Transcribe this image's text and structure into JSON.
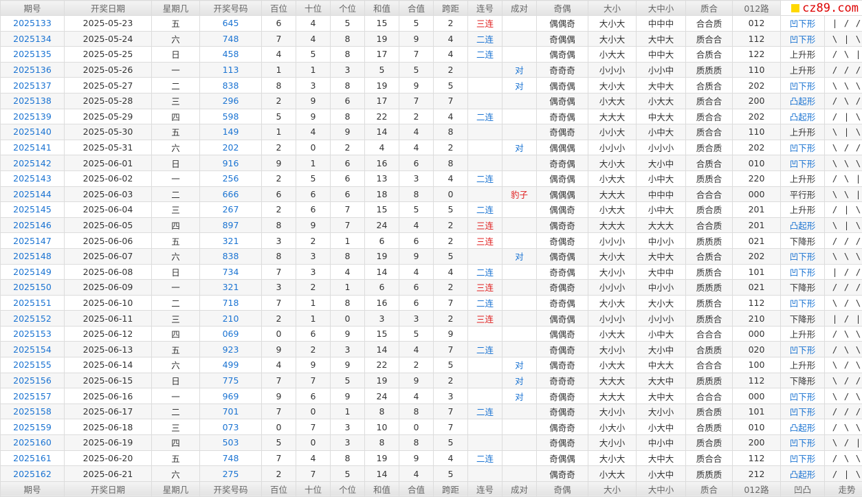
{
  "site": {
    "logo_text": "cz89.com"
  },
  "headers": [
    "期号",
    "开奖日期",
    "星期几",
    "开奖号码",
    "百位",
    "十位",
    "个位",
    "和值",
    "合值",
    "跨距",
    "连号",
    "成对",
    "奇偶",
    "大小",
    "大中小",
    "质合",
    "012路",
    "凹凸",
    "走势"
  ],
  "footer": [
    "期号",
    "开奖日期",
    "星期几",
    "开奖号码",
    "百位",
    "十位",
    "个位",
    "和值",
    "合值",
    "跨距",
    "连号",
    "成对",
    "奇偶",
    "大小",
    "大中小",
    "质合",
    "012路",
    "凹凸",
    "走势"
  ],
  "colors": {
    "blue": "#1a73d2",
    "red": "#e02020",
    "logo_red": "#dd0000",
    "logo_yellow": "#ffd800"
  },
  "rows": [
    {
      "issue": "2025133",
      "date": "2025-05-23",
      "weekday": "五",
      "number": "645",
      "hundreds": "6",
      "tens": "4",
      "units": "5",
      "sum": "15",
      "sum_tail": "5",
      "span": "2",
      "consecutive": "三连",
      "pair": "",
      "odd_even": "偶偶奇",
      "size": "大小大",
      "big_mid_small": "中中中",
      "prime": "合合质",
      "route": "012",
      "shape": "凹下形",
      "trend": "| / /"
    },
    {
      "issue": "2025134",
      "date": "2025-05-24",
      "weekday": "六",
      "number": "748",
      "hundreds": "7",
      "tens": "4",
      "units": "8",
      "sum": "19",
      "sum_tail": "9",
      "span": "4",
      "consecutive": "二连",
      "pair": "",
      "odd_even": "奇偶偶",
      "size": "大小大",
      "big_mid_small": "大中大",
      "prime": "质合合",
      "route": "112",
      "shape": "凹下形",
      "trend": "\\ | \\"
    },
    {
      "issue": "2025135",
      "date": "2025-05-25",
      "weekday": "日",
      "number": "458",
      "hundreds": "4",
      "tens": "5",
      "units": "8",
      "sum": "17",
      "sum_tail": "7",
      "span": "4",
      "consecutive": "二连",
      "pair": "",
      "odd_even": "偶奇偶",
      "size": "小大大",
      "big_mid_small": "中中大",
      "prime": "合质合",
      "route": "122",
      "shape": "上升形",
      "trend": "/ \\ |"
    },
    {
      "issue": "2025136",
      "date": "2025-05-26",
      "weekday": "一",
      "number": "113",
      "hundreds": "1",
      "tens": "1",
      "units": "3",
      "sum": "5",
      "sum_tail": "5",
      "span": "2",
      "consecutive": "",
      "pair": "对",
      "odd_even": "奇奇奇",
      "size": "小小小",
      "big_mid_small": "小小中",
      "prime": "质质质",
      "route": "110",
      "shape": "上升形",
      "trend": "/ / /"
    },
    {
      "issue": "2025137",
      "date": "2025-05-27",
      "weekday": "二",
      "number": "838",
      "hundreds": "8",
      "tens": "3",
      "units": "8",
      "sum": "19",
      "sum_tail": "9",
      "span": "5",
      "consecutive": "",
      "pair": "对",
      "odd_even": "偶奇偶",
      "size": "大小大",
      "big_mid_small": "大中大",
      "prime": "合质合",
      "route": "202",
      "shape": "凹下形",
      "trend": "\\ \\ \\"
    },
    {
      "issue": "2025138",
      "date": "2025-05-28",
      "weekday": "三",
      "number": "296",
      "hundreds": "2",
      "tens": "9",
      "units": "6",
      "sum": "17",
      "sum_tail": "7",
      "span": "7",
      "consecutive": "",
      "pair": "",
      "odd_even": "偶奇偶",
      "size": "小大大",
      "big_mid_small": "小大大",
      "prime": "质合合",
      "route": "200",
      "shape": "凸起形",
      "trend": "/ \\ /"
    },
    {
      "issue": "2025139",
      "date": "2025-05-29",
      "weekday": "四",
      "number": "598",
      "hundreds": "5",
      "tens": "9",
      "units": "8",
      "sum": "22",
      "sum_tail": "2",
      "span": "4",
      "consecutive": "二连",
      "pair": "",
      "odd_even": "奇奇偶",
      "size": "大大大",
      "big_mid_small": "中大大",
      "prime": "质合合",
      "route": "202",
      "shape": "凸起形",
      "trend": "/ | \\"
    },
    {
      "issue": "2025140",
      "date": "2025-05-30",
      "weekday": "五",
      "number": "149",
      "hundreds": "1",
      "tens": "4",
      "units": "9",
      "sum": "14",
      "sum_tail": "4",
      "span": "8",
      "consecutive": "",
      "pair": "",
      "odd_even": "奇偶奇",
      "size": "小小大",
      "big_mid_small": "小中大",
      "prime": "质合合",
      "route": "110",
      "shape": "上升形",
      "trend": "\\ | \\"
    },
    {
      "issue": "2025141",
      "date": "2025-05-31",
      "weekday": "六",
      "number": "202",
      "hundreds": "2",
      "tens": "0",
      "units": "2",
      "sum": "4",
      "sum_tail": "4",
      "span": "2",
      "consecutive": "",
      "pair": "对",
      "odd_even": "偶偶偶",
      "size": "小小小",
      "big_mid_small": "小小小",
      "prime": "质合质",
      "route": "202",
      "shape": "凹下形",
      "trend": "\\ / /"
    },
    {
      "issue": "2025142",
      "date": "2025-06-01",
      "weekday": "日",
      "number": "916",
      "hundreds": "9",
      "tens": "1",
      "units": "6",
      "sum": "16",
      "sum_tail": "6",
      "span": "8",
      "consecutive": "",
      "pair": "",
      "odd_even": "奇奇偶",
      "size": "大小大",
      "big_mid_small": "大小中",
      "prime": "合质合",
      "route": "010",
      "shape": "凹下形",
      "trend": "\\ \\ \\"
    },
    {
      "issue": "2025143",
      "date": "2025-06-02",
      "weekday": "一",
      "number": "256",
      "hundreds": "2",
      "tens": "5",
      "units": "6",
      "sum": "13",
      "sum_tail": "3",
      "span": "4",
      "consecutive": "二连",
      "pair": "",
      "odd_even": "偶奇偶",
      "size": "小大大",
      "big_mid_small": "小中大",
      "prime": "质质合",
      "route": "220",
      "shape": "上升形",
      "trend": "/ \\ |"
    },
    {
      "issue": "2025144",
      "date": "2025-06-03",
      "weekday": "二",
      "number": "666",
      "hundreds": "6",
      "tens": "6",
      "units": "6",
      "sum": "18",
      "sum_tail": "8",
      "span": "0",
      "consecutive": "",
      "pair": "豹子",
      "odd_even": "偶偶偶",
      "size": "大大大",
      "big_mid_small": "中中中",
      "prime": "合合合",
      "route": "000",
      "shape": "平行形",
      "trend": "\\ \\ |"
    },
    {
      "issue": "2025145",
      "date": "2025-06-04",
      "weekday": "三",
      "number": "267",
      "hundreds": "2",
      "tens": "6",
      "units": "7",
      "sum": "15",
      "sum_tail": "5",
      "span": "5",
      "consecutive": "二连",
      "pair": "",
      "odd_even": "偶偶奇",
      "size": "小大大",
      "big_mid_small": "小中大",
      "prime": "质合质",
      "route": "201",
      "shape": "上升形",
      "trend": "/ | \\"
    },
    {
      "issue": "2025146",
      "date": "2025-06-05",
      "weekday": "四",
      "number": "897",
      "hundreds": "8",
      "tens": "9",
      "units": "7",
      "sum": "24",
      "sum_tail": "4",
      "span": "2",
      "consecutive": "三连",
      "pair": "",
      "odd_even": "偶奇奇",
      "size": "大大大",
      "big_mid_small": "大大大",
      "prime": "合合质",
      "route": "201",
      "shape": "凸起形",
      "trend": "\\ | \\"
    },
    {
      "issue": "2025147",
      "date": "2025-06-06",
      "weekday": "五",
      "number": "321",
      "hundreds": "3",
      "tens": "2",
      "units": "1",
      "sum": "6",
      "sum_tail": "6",
      "span": "2",
      "consecutive": "三连",
      "pair": "",
      "odd_even": "奇偶奇",
      "size": "小小小",
      "big_mid_small": "中小小",
      "prime": "质质质",
      "route": "021",
      "shape": "下降形",
      "trend": "/ / /"
    },
    {
      "issue": "2025148",
      "date": "2025-06-07",
      "weekday": "六",
      "number": "838",
      "hundreds": "8",
      "tens": "3",
      "units": "8",
      "sum": "19",
      "sum_tail": "9",
      "span": "5",
      "consecutive": "",
      "pair": "对",
      "odd_even": "偶奇偶",
      "size": "大小大",
      "big_mid_small": "大中大",
      "prime": "合质合",
      "route": "202",
      "shape": "凹下形",
      "trend": "\\ \\ \\"
    },
    {
      "issue": "2025149",
      "date": "2025-06-08",
      "weekday": "日",
      "number": "734",
      "hundreds": "7",
      "tens": "3",
      "units": "4",
      "sum": "14",
      "sum_tail": "4",
      "span": "4",
      "consecutive": "二连",
      "pair": "",
      "odd_even": "奇奇偶",
      "size": "大小小",
      "big_mid_small": "大中中",
      "prime": "质质合",
      "route": "101",
      "shape": "凹下形",
      "trend": "| / /"
    },
    {
      "issue": "2025150",
      "date": "2025-06-09",
      "weekday": "一",
      "number": "321",
      "hundreds": "3",
      "tens": "2",
      "units": "1",
      "sum": "6",
      "sum_tail": "6",
      "span": "2",
      "consecutive": "三连",
      "pair": "",
      "odd_even": "奇偶奇",
      "size": "小小小",
      "big_mid_small": "中小小",
      "prime": "质质质",
      "route": "021",
      "shape": "下降形",
      "trend": "/ / /"
    },
    {
      "issue": "2025151",
      "date": "2025-06-10",
      "weekday": "二",
      "number": "718",
      "hundreds": "7",
      "tens": "1",
      "units": "8",
      "sum": "16",
      "sum_tail": "6",
      "span": "7",
      "consecutive": "二连",
      "pair": "",
      "odd_even": "奇奇偶",
      "size": "大小大",
      "big_mid_small": "大小大",
      "prime": "质质合",
      "route": "112",
      "shape": "凹下形",
      "trend": "\\ / \\"
    },
    {
      "issue": "2025152",
      "date": "2025-06-11",
      "weekday": "三",
      "number": "210",
      "hundreds": "2",
      "tens": "1",
      "units": "0",
      "sum": "3",
      "sum_tail": "3",
      "span": "2",
      "consecutive": "三连",
      "pair": "",
      "odd_even": "偶奇偶",
      "size": "小小小",
      "big_mid_small": "小小小",
      "prime": "质质合",
      "route": "210",
      "shape": "下降形",
      "trend": "| / |"
    },
    {
      "issue": "2025153",
      "date": "2025-06-12",
      "weekday": "四",
      "number": "069",
      "hundreds": "0",
      "tens": "6",
      "units": "9",
      "sum": "15",
      "sum_tail": "5",
      "span": "9",
      "consecutive": "",
      "pair": "",
      "odd_even": "偶偶奇",
      "size": "小大大",
      "big_mid_small": "小中大",
      "prime": "合合合",
      "route": "000",
      "shape": "上升形",
      "trend": "/ \\ \\"
    },
    {
      "issue": "2025154",
      "date": "2025-06-13",
      "weekday": "五",
      "number": "923",
      "hundreds": "9",
      "tens": "2",
      "units": "3",
      "sum": "14",
      "sum_tail": "4",
      "span": "7",
      "consecutive": "二连",
      "pair": "",
      "odd_even": "奇偶奇",
      "size": "大小小",
      "big_mid_small": "大小中",
      "prime": "合质质",
      "route": "020",
      "shape": "凹下形",
      "trend": "/ \\ \\"
    },
    {
      "issue": "2025155",
      "date": "2025-06-14",
      "weekday": "六",
      "number": "499",
      "hundreds": "4",
      "tens": "9",
      "units": "9",
      "sum": "22",
      "sum_tail": "2",
      "span": "5",
      "consecutive": "",
      "pair": "对",
      "odd_even": "偶奇奇",
      "size": "小大大",
      "big_mid_small": "中大大",
      "prime": "合合合",
      "route": "100",
      "shape": "上升形",
      "trend": "\\ / \\"
    },
    {
      "issue": "2025156",
      "date": "2025-06-15",
      "weekday": "日",
      "number": "775",
      "hundreds": "7",
      "tens": "7",
      "units": "5",
      "sum": "19",
      "sum_tail": "9",
      "span": "2",
      "consecutive": "",
      "pair": "对",
      "odd_even": "奇奇奇",
      "size": "大大大",
      "big_mid_small": "大大中",
      "prime": "质质质",
      "route": "112",
      "shape": "下降形",
      "trend": "\\ / /"
    },
    {
      "issue": "2025157",
      "date": "2025-06-16",
      "weekday": "一",
      "number": "969",
      "hundreds": "9",
      "tens": "6",
      "units": "9",
      "sum": "24",
      "sum_tail": "4",
      "span": "3",
      "consecutive": "",
      "pair": "对",
      "odd_even": "奇偶奇",
      "size": "大大大",
      "big_mid_small": "大中大",
      "prime": "合合合",
      "route": "000",
      "shape": "凹下形",
      "trend": "\\ / \\"
    },
    {
      "issue": "2025158",
      "date": "2025-06-17",
      "weekday": "二",
      "number": "701",
      "hundreds": "7",
      "tens": "0",
      "units": "1",
      "sum": "8",
      "sum_tail": "8",
      "span": "7",
      "consecutive": "二连",
      "pair": "",
      "odd_even": "奇偶奇",
      "size": "大小小",
      "big_mid_small": "大小小",
      "prime": "质合质",
      "route": "101",
      "shape": "凹下形",
      "trend": "/ / /"
    },
    {
      "issue": "2025159",
      "date": "2025-06-18",
      "weekday": "三",
      "number": "073",
      "hundreds": "0",
      "tens": "7",
      "units": "3",
      "sum": "10",
      "sum_tail": "0",
      "span": "7",
      "consecutive": "",
      "pair": "",
      "odd_even": "偶奇奇",
      "size": "小大小",
      "big_mid_small": "小大中",
      "prime": "合质质",
      "route": "010",
      "shape": "凸起形",
      "trend": "/ \\ \\"
    },
    {
      "issue": "2025160",
      "date": "2025-06-19",
      "weekday": "四",
      "number": "503",
      "hundreds": "5",
      "tens": "0",
      "units": "3",
      "sum": "8",
      "sum_tail": "8",
      "span": "5",
      "consecutive": "",
      "pair": "",
      "odd_even": "奇偶奇",
      "size": "大小小",
      "big_mid_small": "中小中",
      "prime": "质合质",
      "route": "200",
      "shape": "凹下形",
      "trend": "\\ / |"
    },
    {
      "issue": "2025161",
      "date": "2025-06-20",
      "weekday": "五",
      "number": "748",
      "hundreds": "7",
      "tens": "4",
      "units": "8",
      "sum": "19",
      "sum_tail": "9",
      "span": "4",
      "consecutive": "二连",
      "pair": "",
      "odd_even": "奇偶偶",
      "size": "大小大",
      "big_mid_small": "大中大",
      "prime": "质合合",
      "route": "112",
      "shape": "凹下形",
      "trend": "/ \\ \\"
    },
    {
      "issue": "2025162",
      "date": "2025-06-21",
      "weekday": "六",
      "number": "275",
      "hundreds": "2",
      "tens": "7",
      "units": "5",
      "sum": "14",
      "sum_tail": "4",
      "span": "5",
      "consecutive": "",
      "pair": "",
      "odd_even": "偶奇奇",
      "size": "小大大",
      "big_mid_small": "小大中",
      "prime": "质质质",
      "route": "212",
      "shape": "凸起形",
      "trend": "/ | \\"
    }
  ]
}
